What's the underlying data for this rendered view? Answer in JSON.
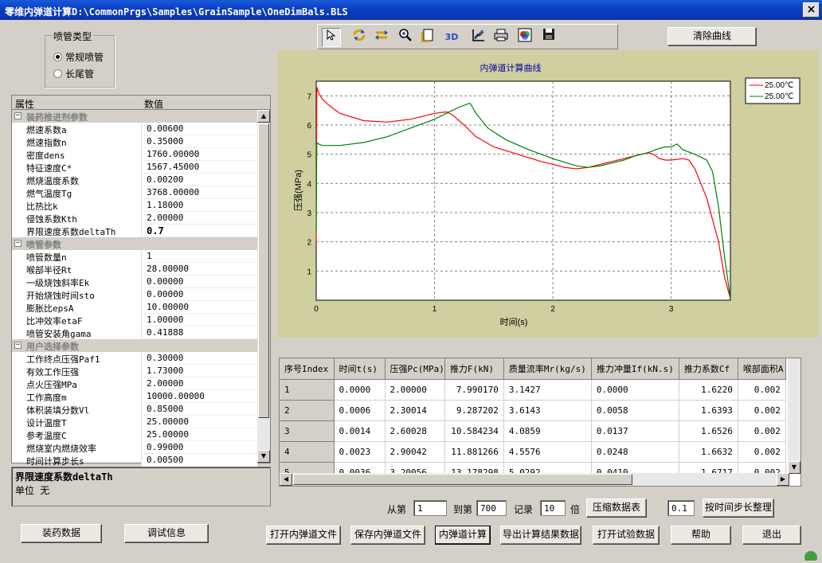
{
  "window": {
    "title": "零维内弹道计算D:\\CommonPrgs\\Samples\\GrainSample\\OneDimBals.BLS",
    "close_label": "×"
  },
  "nozzle_type": {
    "title": "喷管类型",
    "options": [
      "常规喷管",
      "长尾管"
    ],
    "selected": "常规喷管"
  },
  "property_grid": {
    "col_name": "属性",
    "col_value": "数值",
    "rows": [
      {
        "type": "cat",
        "name": "装药推进剂参数",
        "toggle": "−"
      },
      {
        "type": "row",
        "name": "燃速系数a",
        "value": "0.00600"
      },
      {
        "type": "row",
        "name": "燃速指数n",
        "value": "0.35000"
      },
      {
        "type": "row",
        "name": "密度dens",
        "value": "1760.00000"
      },
      {
        "type": "row",
        "name": "特征速度C*",
        "value": "1567.45000"
      },
      {
        "type": "row",
        "name": "燃烧温度系数",
        "value": "0.00200"
      },
      {
        "type": "row",
        "name": "燃气温度Tg",
        "value": "3768.00000"
      },
      {
        "type": "row",
        "name": "比热比k",
        "value": "1.18000"
      },
      {
        "type": "row",
        "name": "侵蚀系数Kth",
        "value": "2.00000"
      },
      {
        "type": "row",
        "name": "界限速度系数deltaTh",
        "value": "0.7",
        "selected": true
      },
      {
        "type": "cat",
        "name": "喷管参数",
        "toggle": "−"
      },
      {
        "type": "row",
        "name": "喷管数量n",
        "value": "1"
      },
      {
        "type": "row",
        "name": "喉部半径Rt",
        "value": "28.00000"
      },
      {
        "type": "row",
        "name": "一级烧蚀斜率Ek",
        "value": "0.00000"
      },
      {
        "type": "row",
        "name": "开始烧蚀时间sto",
        "value": "0.00000"
      },
      {
        "type": "row",
        "name": "膨胀比epsA",
        "value": "10.00000"
      },
      {
        "type": "row",
        "name": "比冲效率etaF",
        "value": "1.00000"
      },
      {
        "type": "row",
        "name": "喷管安装角gama",
        "value": "0.41888"
      },
      {
        "type": "cat",
        "name": "用户选择参数",
        "toggle": "−"
      },
      {
        "type": "row",
        "name": "工作终点压强Paf1",
        "value": "0.30000"
      },
      {
        "type": "row",
        "name": "有效工作压强",
        "value": "1.73000"
      },
      {
        "type": "row",
        "name": "点火压强MPa",
        "value": "2.00000"
      },
      {
        "type": "row",
        "name": "工作高度m",
        "value": "10000.00000"
      },
      {
        "type": "row",
        "name": "体积装填分数Vl",
        "value": "0.85000"
      },
      {
        "type": "row",
        "name": "设计温度T",
        "value": "25.00000"
      },
      {
        "type": "row",
        "name": "参考温度C",
        "value": "25.00000"
      },
      {
        "type": "row",
        "name": "燃烧室内燃烧效率",
        "value": "0.99000"
      },
      {
        "type": "row",
        "name": "时间计算步长s",
        "value": "0.00500"
      }
    ]
  },
  "description": {
    "title": "界限速度系数deltaTh",
    "unit": "单位 无"
  },
  "toolbar": {
    "icons": [
      "pointer-icon",
      "rotate-icon",
      "pan-icon",
      "zoom-icon",
      "page-icon",
      "3d-icon",
      "chart-edit-icon",
      "print-icon",
      "palette-icon",
      "save-icon"
    ],
    "label_3d": "3D"
  },
  "clear_button": "清除曲线",
  "chart_data": {
    "type": "line",
    "title": "内弹道计算曲线",
    "xlabel": "时间(s)",
    "ylabel": "压强(MPa)",
    "xlim": [
      0,
      3.5
    ],
    "ylim": [
      0,
      7.5
    ],
    "xticks": [
      0,
      1,
      2,
      3
    ],
    "yticks": [
      1,
      2,
      3,
      4,
      5,
      6,
      7
    ],
    "grid": true,
    "legend_position": "top-right",
    "series": [
      {
        "name": "25.00℃",
        "color": "#ff0000",
        "x": [
          0,
          0.005,
          0.02,
          0.05,
          0.1,
          0.2,
          0.4,
          0.6,
          0.8,
          1.0,
          1.1,
          1.15,
          1.25,
          1.35,
          1.5,
          1.7,
          1.9,
          2.1,
          2.2,
          2.3,
          2.4,
          2.5,
          2.6,
          2.7,
          2.8,
          2.85,
          2.9,
          2.95,
          3.0,
          3.1,
          3.15,
          3.2,
          3.3,
          3.4,
          3.45,
          3.5
        ],
        "y": [
          2.0,
          7.3,
          7.1,
          6.9,
          6.7,
          6.4,
          6.15,
          6.1,
          6.2,
          6.4,
          6.45,
          6.35,
          6.0,
          5.6,
          5.25,
          5.0,
          4.75,
          4.55,
          4.5,
          4.55,
          4.65,
          4.75,
          4.85,
          4.95,
          5.05,
          5.0,
          4.85,
          4.8,
          4.8,
          4.85,
          4.8,
          4.5,
          3.5,
          2.0,
          0.8,
          0.05
        ]
      },
      {
        "name": "25.00℃",
        "color": "#008000",
        "x": [
          0,
          0.005,
          0.02,
          0.05,
          0.2,
          0.4,
          0.6,
          0.8,
          1.0,
          1.1,
          1.2,
          1.3,
          1.35,
          1.45,
          1.6,
          1.8,
          2.0,
          2.2,
          2.3,
          2.4,
          2.5,
          2.6,
          2.7,
          2.8,
          2.9,
          2.95,
          3.0,
          3.05,
          3.1,
          3.2,
          3.3,
          3.35,
          3.4,
          3.45,
          3.5
        ],
        "y": [
          2.3,
          5.4,
          5.35,
          5.3,
          5.3,
          5.4,
          5.6,
          5.9,
          6.2,
          6.4,
          6.6,
          6.75,
          6.4,
          5.9,
          5.5,
          5.15,
          4.85,
          4.6,
          4.55,
          4.6,
          4.7,
          4.8,
          4.95,
          5.05,
          5.2,
          5.25,
          5.25,
          5.35,
          5.15,
          5.0,
          4.8,
          4.4,
          3.2,
          1.5,
          0.05
        ]
      }
    ]
  },
  "results_table": {
    "headers": [
      "序号Index",
      "时间t(s)",
      "压强Pc(MPa)",
      "推力F(kN)",
      "质量流率Mr(kg/s)",
      "推力冲量If(kN.s)",
      "推力系数Cf",
      "喉部面积A"
    ],
    "rows": [
      [
        "1",
        "0.0000",
        "2.00000",
        "7.990170",
        "3.1427",
        "0.0000",
        "1.6220",
        "0.002"
      ],
      [
        "2",
        "0.0006",
        "2.30014",
        "9.287202",
        "3.6143",
        "0.0058",
        "1.6393",
        "0.002"
      ],
      [
        "3",
        "0.0014",
        "2.60028",
        "10.584234",
        "4.0859",
        "0.0137",
        "1.6526",
        "0.002"
      ],
      [
        "4",
        "0.0023",
        "2.90042",
        "11.881266",
        "4.5576",
        "0.0248",
        "1.6632",
        "0.002"
      ],
      [
        "5",
        "0.0036",
        "3.20056",
        "13.178298",
        "5.0292",
        "0.0410",
        "1.6717",
        "0.002"
      ]
    ]
  },
  "range": {
    "from_label": "从第",
    "from_value": "1",
    "to_label": "到第",
    "to_value": "700",
    "record_label": "记录",
    "factor_value": "10",
    "factor_label": "倍",
    "compress_button": "压缩数据表",
    "step_value": "0.1",
    "step_button": "按时间步长整理"
  },
  "bottom_buttons": {
    "grain_data": "装药数据",
    "debug_info": "调试信息",
    "open_file": "打开内弹道文件",
    "save_file": "保存内弹道文件",
    "calculate": "内弹道计算",
    "export": "导出计算结果数据",
    "open_test": "打开试验数据",
    "help": "帮助",
    "exit": "退出"
  }
}
